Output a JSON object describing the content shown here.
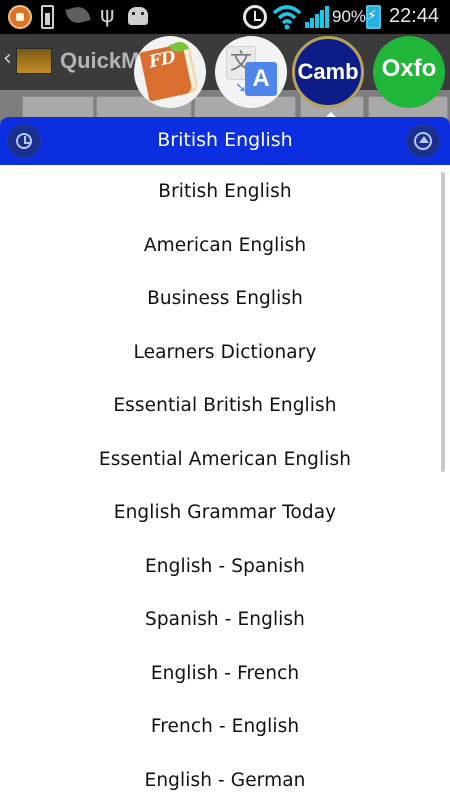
{
  "status_bar": {
    "battery_percent": "90%",
    "time": "22:44"
  },
  "background_app": {
    "title": "QuickM"
  },
  "bubbles": [
    {
      "label": "FD",
      "color": "#d96e2e"
    },
    {
      "label": "文",
      "color": "#4f86ec"
    },
    {
      "label": "A",
      "color": "#4f86ec"
    },
    {
      "label": "Camb",
      "color": "#0c1d8a"
    },
    {
      "label": "Oxfo",
      "color": "#21b63a"
    }
  ],
  "dropdown": {
    "selected": "British English",
    "header_color": "#0a2ee0",
    "items": [
      "British English",
      "American English",
      "Business English",
      "Learners Dictionary",
      "Essential British English",
      "Essential American English",
      "English Grammar Today",
      "English - Spanish",
      "Spanish - English",
      "English - French",
      "French - English",
      "English - German"
    ]
  }
}
